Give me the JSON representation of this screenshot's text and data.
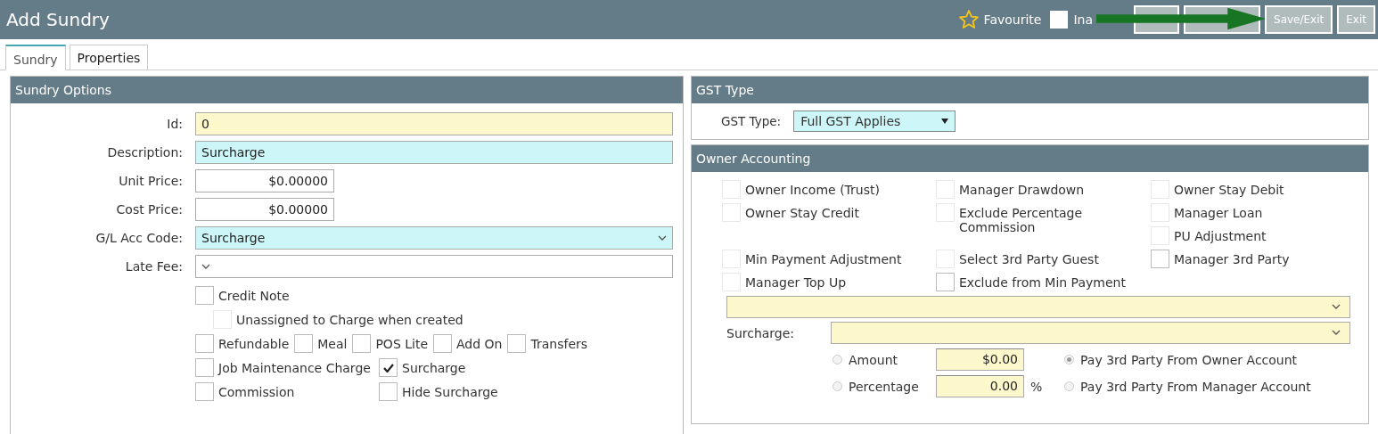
{
  "window": {
    "title": "Add Sundry"
  },
  "header": {
    "favourite": {
      "label": "Favourite",
      "checked": false
    },
    "inactive": {
      "label": "Ina",
      "checked": false
    },
    "buttons": [
      {
        "kind": "blank"
      },
      {
        "kind": "blank"
      },
      {
        "kind": "text",
        "label": "Save/Exit"
      },
      {
        "kind": "text",
        "label": "Exit"
      }
    ]
  },
  "tabs": [
    {
      "label": "Sundry",
      "selected": true
    },
    {
      "label": "Properties",
      "selected": false
    }
  ],
  "sundry_options": {
    "title": "Sundry Options",
    "fields": [
      {
        "label": "Id:",
        "value": "0",
        "kind": "text",
        "color": "#fdf8cc"
      },
      {
        "label": "Description:",
        "value": "Surcharge",
        "kind": "text",
        "color": "#cdf6f8"
      },
      {
        "label": "Unit Price:",
        "value": "$0.00000",
        "kind": "amount",
        "color": "#ffffff"
      },
      {
        "label": "Cost Price:",
        "value": "$0.00000",
        "kind": "amount",
        "color": "#ffffff"
      },
      {
        "label": "G/L Acc Code:",
        "value": "Surcharge",
        "kind": "select",
        "color": "#cdf6f8"
      },
      {
        "label": "Late Fee:",
        "kind": "select",
        "color": "#ffffff"
      }
    ],
    "flag_rows": [
      {
        "kind": "flow",
        "indented": false,
        "items": [
          {
            "label": "Credit Note",
            "checked": false,
            "disabled": false
          }
        ]
      },
      {
        "kind": "flow",
        "indented": true,
        "items": [
          {
            "label": "Unassigned to Charge when created",
            "checked": false,
            "disabled": true
          }
        ]
      },
      {
        "kind": "flow",
        "indented": false,
        "items": [
          {
            "label": "Refundable",
            "checked": false,
            "disabled": false
          },
          {
            "label": "Meal",
            "checked": false,
            "disabled": false
          },
          {
            "label": "POS Lite",
            "checked": false,
            "disabled": false
          },
          {
            "label": "Add On",
            "checked": false,
            "disabled": false
          },
          {
            "label": "Transfers",
            "checked": false,
            "disabled": false
          }
        ]
      },
      {
        "kind": "columns",
        "indented": false,
        "items": [
          {
            "label": "Job Maintenance Charge",
            "checked": false,
            "disabled": false
          },
          {
            "label": "Surcharge",
            "checked": true,
            "disabled": false
          }
        ]
      },
      {
        "kind": "columns",
        "indented": false,
        "items": [
          {
            "label": "Commission",
            "checked": false,
            "disabled": false
          },
          {
            "label": "Hide Surcharge",
            "checked": false,
            "disabled": false
          }
        ]
      }
    ]
  },
  "gst_type": {
    "title": "GST Type",
    "label": "GST Type:",
    "value": "Full GST Applies"
  },
  "owner_accounting": {
    "title": "Owner Accounting",
    "rows": [
      [
        [
          {
            "label": "Owner Income (Trust)",
            "checked": false,
            "disabled": true
          }
        ],
        [
          {
            "label": "Manager Drawdown",
            "checked": false,
            "disabled": true
          }
        ],
        [
          {
            "label": "Owner Stay Debit",
            "checked": false,
            "disabled": true
          }
        ]
      ],
      [
        [
          {
            "label": "Owner Stay Credit",
            "checked": false,
            "disabled": true
          }
        ],
        [
          {
            "label": "Exclude Percentage Commission",
            "checked": false,
            "disabled": true
          }
        ],
        [
          {
            "label": "Manager Loan",
            "checked": false,
            "disabled": true
          },
          {
            "label": "PU Adjustment",
            "checked": false,
            "disabled": true
          }
        ]
      ],
      [
        [
          {
            "label": "Min Payment Adjustment",
            "checked": false,
            "disabled": true
          }
        ],
        [
          {
            "label": "Select 3rd Party Guest",
            "checked": false,
            "disabled": true
          }
        ],
        [
          {
            "label": "Manager 3rd Party",
            "checked": false,
            "disabled": false
          }
        ]
      ],
      [
        [
          {
            "label": "Manager Top Up",
            "checked": false,
            "disabled": true
          }
        ],
        [
          {
            "label": "Exclude from Min Payment",
            "checked": false,
            "disabled": false
          }
        ]
      ]
    ],
    "surcharge_label": "Surcharge:",
    "amount_rows": [
      {
        "label": "Amount",
        "selected": false,
        "value": "$0.00",
        "pay_label": "Pay 3rd Party From Owner Account",
        "pay_selected": true
      },
      {
        "label": "Percentage",
        "selected": false,
        "value": "0.00",
        "unit": "%",
        "pay_label": "Pay 3rd Party From Manager Account",
        "pay_selected": false
      }
    ]
  }
}
